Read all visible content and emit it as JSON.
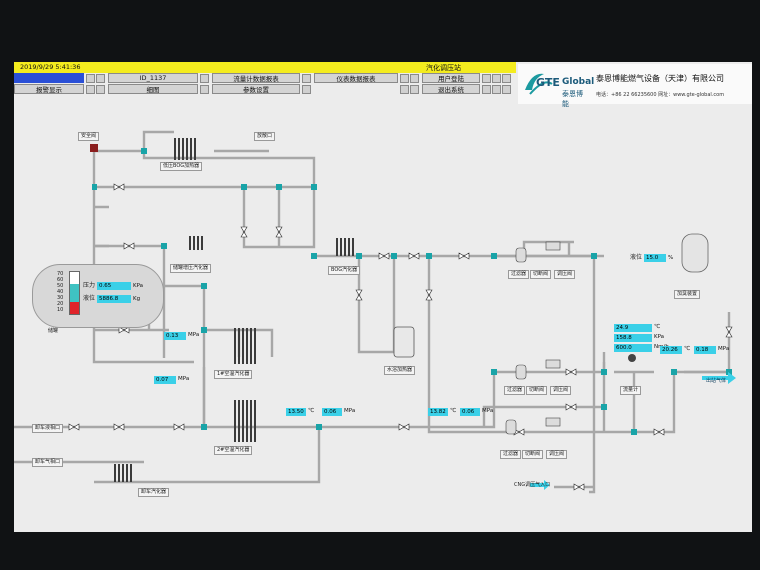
{
  "header": {
    "datetime": "2019/9/29  5:41:36",
    "station_title": "汽化调压站",
    "nav_row1": [
      "ID_1137",
      "流量计数据报表",
      "仪表数据报表",
      "用户登陆"
    ],
    "nav_row2": [
      "报警显示",
      "细图",
      "参数设置",
      "退出系统"
    ]
  },
  "brand": {
    "logo_text": "GTE",
    "logo_word": "Global",
    "logo_cn": "泰恩博能",
    "company": "泰恩博能燃气设备（天津）有限公司",
    "contact": "电话：+86 22 66235600    网址：www.gte-global.com"
  },
  "tank": {
    "name": "储罐",
    "pressure_label": "压力",
    "pressure_value": "0.65",
    "pressure_unit": "KPa",
    "level_label": "液位",
    "level_value": "5886.8",
    "level_unit": "Kg",
    "scale": [
      "70",
      "60",
      "50",
      "40",
      "30",
      "20",
      "10"
    ]
  },
  "labels": {
    "safety_valve": "安全阀",
    "low_heater": "低压BOG加热器",
    "vent": "放散口",
    "tank_booster": "储罐增压汽化器",
    "bog_vaporizer": "BOG汽化器",
    "filter": "过滤器",
    "shutoff": "切断阀",
    "regulator": "调压阀",
    "odorizer": "加臭装置",
    "level": "液位",
    "flowmeter": "流量计",
    "outlet": "出站气体",
    "water_heater": "水浴加热器",
    "air_vap1": "1#空温汽化器",
    "air_vap2": "2#空温汽化器",
    "unload_liquid": "卸车液相口",
    "unload_gas": "卸车气相口",
    "unload_vap": "卸车汽化器",
    "cng_inlet": "CNG调压气入口"
  },
  "readings": {
    "odor_level": "15.0",
    "odor_unit": "%",
    "temp_flow": "24.9",
    "temp_unit": "℃",
    "pressure_flow": "158.8",
    "pressure_flow_unit": "KPa",
    "flow_rate": "600.0",
    "flow_unit": "Nm/h",
    "outlet_temp": "20.26",
    "outlet_pressure": "0.18",
    "mpa": "MPa",
    "r1": "0.13",
    "r2": "0.07",
    "r3_temp": "13.50",
    "r3_press": "0.06",
    "r4_temp": "13.82",
    "r4_press": "0.06"
  },
  "colors": {
    "title_bar": "#f4ec1e",
    "value_box": "#3ad0e8",
    "pipe": "#a7a7a7",
    "joint": "#19a4a8",
    "tank_fill": "#3fc2c2",
    "alarm_red": "#e0242a"
  }
}
